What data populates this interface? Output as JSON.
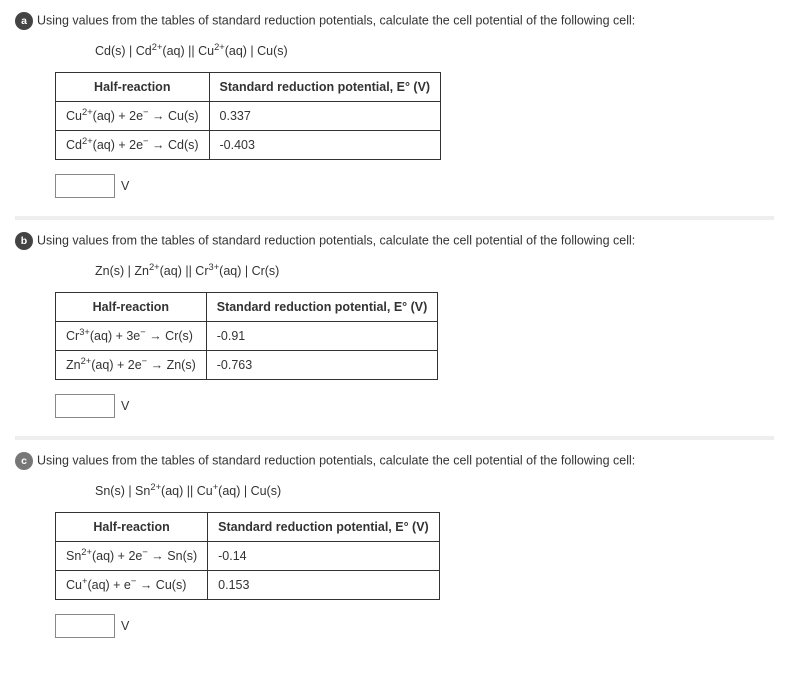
{
  "questions": [
    {
      "badge": "a",
      "badge_class": "",
      "prompt": "Using values from the tables of standard reduction potentials, calculate the cell potential of the following cell:",
      "cell_notation_html": "Cd(s) | Cd<sup>2+</sup>(aq) || Cu<sup>2+</sup>(aq) | Cu(s)",
      "table": {
        "headers": [
          "Half-reaction",
          "Standard reduction potential, E° (V)"
        ],
        "rows": [
          {
            "reaction_html": "Cu<sup>2+</sup>(aq) + 2e<sup>−</sup> → Cu(s)",
            "potential": "0.337"
          },
          {
            "reaction_html": "Cd<sup>2+</sup>(aq) + 2e<sup>−</sup> → Cd(s)",
            "potential": "-0.403"
          }
        ]
      },
      "unit": "V"
    },
    {
      "badge": "b",
      "badge_class": "",
      "prompt": "Using values from the tables of standard reduction potentials, calculate the cell potential of the following cell:",
      "cell_notation_html": "Zn(s) | Zn<sup>2+</sup>(aq) || Cr<sup>3+</sup>(aq) | Cr(s)",
      "table": {
        "headers": [
          "Half-reaction",
          "Standard reduction potential, E° (V)"
        ],
        "rows": [
          {
            "reaction_html": "Cr<sup>3+</sup>(aq) + 3e<sup>−</sup> → Cr(s)",
            "potential": "-0.91"
          },
          {
            "reaction_html": "Zn<sup>2+</sup>(aq) + 2e<sup>−</sup> → Zn(s)",
            "potential": "-0.763"
          }
        ]
      },
      "unit": "V"
    },
    {
      "badge": "c",
      "badge_class": "c",
      "prompt": "Using values from the tables of standard reduction potentials, calculate the cell potential of the following cell:",
      "cell_notation_html": "Sn(s) | Sn<sup>2+</sup>(aq) || Cu<sup>+</sup>(aq) | Cu(s)",
      "table": {
        "headers": [
          "Half-reaction",
          "Standard reduction potential, E° (V)"
        ],
        "rows": [
          {
            "reaction_html": "Sn<sup>2+</sup>(aq) + 2e<sup>−</sup> → Sn(s)",
            "potential": "-0.14"
          },
          {
            "reaction_html": "Cu<sup>+</sup>(aq) + e<sup>−</sup> → Cu(s)",
            "potential": "0.153"
          }
        ]
      },
      "unit": "V"
    }
  ]
}
